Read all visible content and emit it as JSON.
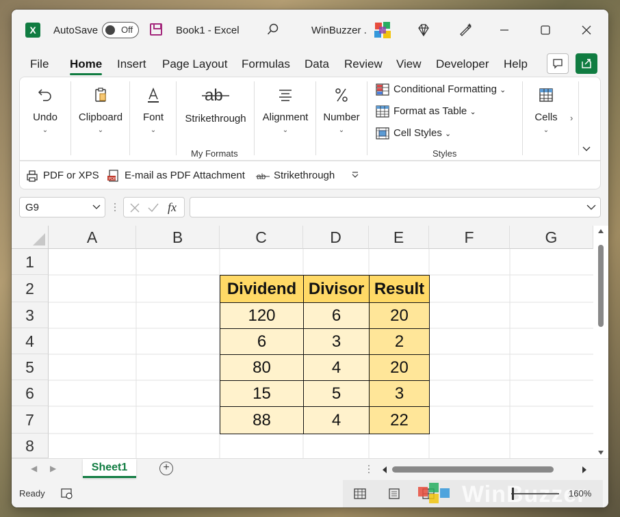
{
  "titlebar": {
    "autosave_label": "AutoSave",
    "autosave_state": "Off",
    "doc_title": "Book1  -  Excel",
    "brand": "WinBuzzer ."
  },
  "tabs": [
    "File",
    "Home",
    "Insert",
    "Page Layout",
    "Formulas",
    "Data",
    "Review",
    "View",
    "Developer",
    "Help"
  ],
  "active_tab": "Home",
  "ribbon": {
    "undo": "Undo",
    "clipboard": "Clipboard",
    "font": "Font",
    "strikethrough": "Strikethrough",
    "my_formats": "My Formats",
    "alignment": "Alignment",
    "number": "Number",
    "conditional_formatting": "Conditional Formatting",
    "format_as_table": "Format as Table",
    "cell_styles": "Cell Styles",
    "styles": "Styles",
    "cells": "Cells",
    "chevron": "⌄"
  },
  "qat": {
    "pdf_xps": "PDF or XPS",
    "email_pdf": "E-mail as PDF Attachment",
    "strikethrough": "Strikethrough"
  },
  "formula_bar": {
    "name_box": "G9",
    "fx": "fx",
    "value": ""
  },
  "grid": {
    "columns": [
      "A",
      "B",
      "C",
      "D",
      "E",
      "F",
      "G"
    ],
    "rows": [
      "1",
      "2",
      "3",
      "4",
      "5",
      "6",
      "7",
      "8"
    ],
    "table_header": [
      "Dividend",
      "Divisor",
      "Result"
    ],
    "table_rows": [
      [
        "120",
        "6",
        "20"
      ],
      [
        "6",
        "3",
        "2"
      ],
      [
        "80",
        "4",
        "20"
      ],
      [
        "15",
        "5",
        "3"
      ],
      [
        "88",
        "4",
        "22"
      ]
    ]
  },
  "sheets": {
    "active": "Sheet1",
    "add_label": "+"
  },
  "status": {
    "ready": "Ready",
    "zoom": "160%",
    "watermark": "WinBuzzer"
  },
  "colors": {
    "accent": "#107c41",
    "header_fill": "#ffd966",
    "light_fill": "#fff2cc",
    "result_fill": "#ffe699"
  }
}
